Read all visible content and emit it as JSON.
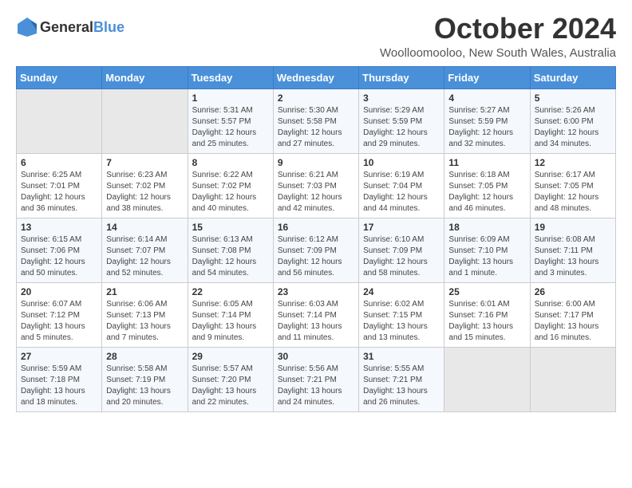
{
  "header": {
    "logo_general": "General",
    "logo_blue": "Blue",
    "month_title": "October 2024",
    "location": "Woolloomooloo, New South Wales, Australia"
  },
  "days_of_week": [
    "Sunday",
    "Monday",
    "Tuesday",
    "Wednesday",
    "Thursday",
    "Friday",
    "Saturday"
  ],
  "weeks": [
    [
      {
        "day": "",
        "sunrise": "",
        "sunset": "",
        "daylight": ""
      },
      {
        "day": "",
        "sunrise": "",
        "sunset": "",
        "daylight": ""
      },
      {
        "day": "1",
        "sunrise": "Sunrise: 5:31 AM",
        "sunset": "Sunset: 5:57 PM",
        "daylight": "Daylight: 12 hours and 25 minutes."
      },
      {
        "day": "2",
        "sunrise": "Sunrise: 5:30 AM",
        "sunset": "Sunset: 5:58 PM",
        "daylight": "Daylight: 12 hours and 27 minutes."
      },
      {
        "day": "3",
        "sunrise": "Sunrise: 5:29 AM",
        "sunset": "Sunset: 5:59 PM",
        "daylight": "Daylight: 12 hours and 29 minutes."
      },
      {
        "day": "4",
        "sunrise": "Sunrise: 5:27 AM",
        "sunset": "Sunset: 5:59 PM",
        "daylight": "Daylight: 12 hours and 32 minutes."
      },
      {
        "day": "5",
        "sunrise": "Sunrise: 5:26 AM",
        "sunset": "Sunset: 6:00 PM",
        "daylight": "Daylight: 12 hours and 34 minutes."
      }
    ],
    [
      {
        "day": "6",
        "sunrise": "Sunrise: 6:25 AM",
        "sunset": "Sunset: 7:01 PM",
        "daylight": "Daylight: 12 hours and 36 minutes."
      },
      {
        "day": "7",
        "sunrise": "Sunrise: 6:23 AM",
        "sunset": "Sunset: 7:02 PM",
        "daylight": "Daylight: 12 hours and 38 minutes."
      },
      {
        "day": "8",
        "sunrise": "Sunrise: 6:22 AM",
        "sunset": "Sunset: 7:02 PM",
        "daylight": "Daylight: 12 hours and 40 minutes."
      },
      {
        "day": "9",
        "sunrise": "Sunrise: 6:21 AM",
        "sunset": "Sunset: 7:03 PM",
        "daylight": "Daylight: 12 hours and 42 minutes."
      },
      {
        "day": "10",
        "sunrise": "Sunrise: 6:19 AM",
        "sunset": "Sunset: 7:04 PM",
        "daylight": "Daylight: 12 hours and 44 minutes."
      },
      {
        "day": "11",
        "sunrise": "Sunrise: 6:18 AM",
        "sunset": "Sunset: 7:05 PM",
        "daylight": "Daylight: 12 hours and 46 minutes."
      },
      {
        "day": "12",
        "sunrise": "Sunrise: 6:17 AM",
        "sunset": "Sunset: 7:05 PM",
        "daylight": "Daylight: 12 hours and 48 minutes."
      }
    ],
    [
      {
        "day": "13",
        "sunrise": "Sunrise: 6:15 AM",
        "sunset": "Sunset: 7:06 PM",
        "daylight": "Daylight: 12 hours and 50 minutes."
      },
      {
        "day": "14",
        "sunrise": "Sunrise: 6:14 AM",
        "sunset": "Sunset: 7:07 PM",
        "daylight": "Daylight: 12 hours and 52 minutes."
      },
      {
        "day": "15",
        "sunrise": "Sunrise: 6:13 AM",
        "sunset": "Sunset: 7:08 PM",
        "daylight": "Daylight: 12 hours and 54 minutes."
      },
      {
        "day": "16",
        "sunrise": "Sunrise: 6:12 AM",
        "sunset": "Sunset: 7:09 PM",
        "daylight": "Daylight: 12 hours and 56 minutes."
      },
      {
        "day": "17",
        "sunrise": "Sunrise: 6:10 AM",
        "sunset": "Sunset: 7:09 PM",
        "daylight": "Daylight: 12 hours and 58 minutes."
      },
      {
        "day": "18",
        "sunrise": "Sunrise: 6:09 AM",
        "sunset": "Sunset: 7:10 PM",
        "daylight": "Daylight: 13 hours and 1 minute."
      },
      {
        "day": "19",
        "sunrise": "Sunrise: 6:08 AM",
        "sunset": "Sunset: 7:11 PM",
        "daylight": "Daylight: 13 hours and 3 minutes."
      }
    ],
    [
      {
        "day": "20",
        "sunrise": "Sunrise: 6:07 AM",
        "sunset": "Sunset: 7:12 PM",
        "daylight": "Daylight: 13 hours and 5 minutes."
      },
      {
        "day": "21",
        "sunrise": "Sunrise: 6:06 AM",
        "sunset": "Sunset: 7:13 PM",
        "daylight": "Daylight: 13 hours and 7 minutes."
      },
      {
        "day": "22",
        "sunrise": "Sunrise: 6:05 AM",
        "sunset": "Sunset: 7:14 PM",
        "daylight": "Daylight: 13 hours and 9 minutes."
      },
      {
        "day": "23",
        "sunrise": "Sunrise: 6:03 AM",
        "sunset": "Sunset: 7:14 PM",
        "daylight": "Daylight: 13 hours and 11 minutes."
      },
      {
        "day": "24",
        "sunrise": "Sunrise: 6:02 AM",
        "sunset": "Sunset: 7:15 PM",
        "daylight": "Daylight: 13 hours and 13 minutes."
      },
      {
        "day": "25",
        "sunrise": "Sunrise: 6:01 AM",
        "sunset": "Sunset: 7:16 PM",
        "daylight": "Daylight: 13 hours and 15 minutes."
      },
      {
        "day": "26",
        "sunrise": "Sunrise: 6:00 AM",
        "sunset": "Sunset: 7:17 PM",
        "daylight": "Daylight: 13 hours and 16 minutes."
      }
    ],
    [
      {
        "day": "27",
        "sunrise": "Sunrise: 5:59 AM",
        "sunset": "Sunset: 7:18 PM",
        "daylight": "Daylight: 13 hours and 18 minutes."
      },
      {
        "day": "28",
        "sunrise": "Sunrise: 5:58 AM",
        "sunset": "Sunset: 7:19 PM",
        "daylight": "Daylight: 13 hours and 20 minutes."
      },
      {
        "day": "29",
        "sunrise": "Sunrise: 5:57 AM",
        "sunset": "Sunset: 7:20 PM",
        "daylight": "Daylight: 13 hours and 22 minutes."
      },
      {
        "day": "30",
        "sunrise": "Sunrise: 5:56 AM",
        "sunset": "Sunset: 7:21 PM",
        "daylight": "Daylight: 13 hours and 24 minutes."
      },
      {
        "day": "31",
        "sunrise": "Sunrise: 5:55 AM",
        "sunset": "Sunset: 7:21 PM",
        "daylight": "Daylight: 13 hours and 26 minutes."
      },
      {
        "day": "",
        "sunrise": "",
        "sunset": "",
        "daylight": ""
      },
      {
        "day": "",
        "sunrise": "",
        "sunset": "",
        "daylight": ""
      }
    ]
  ]
}
